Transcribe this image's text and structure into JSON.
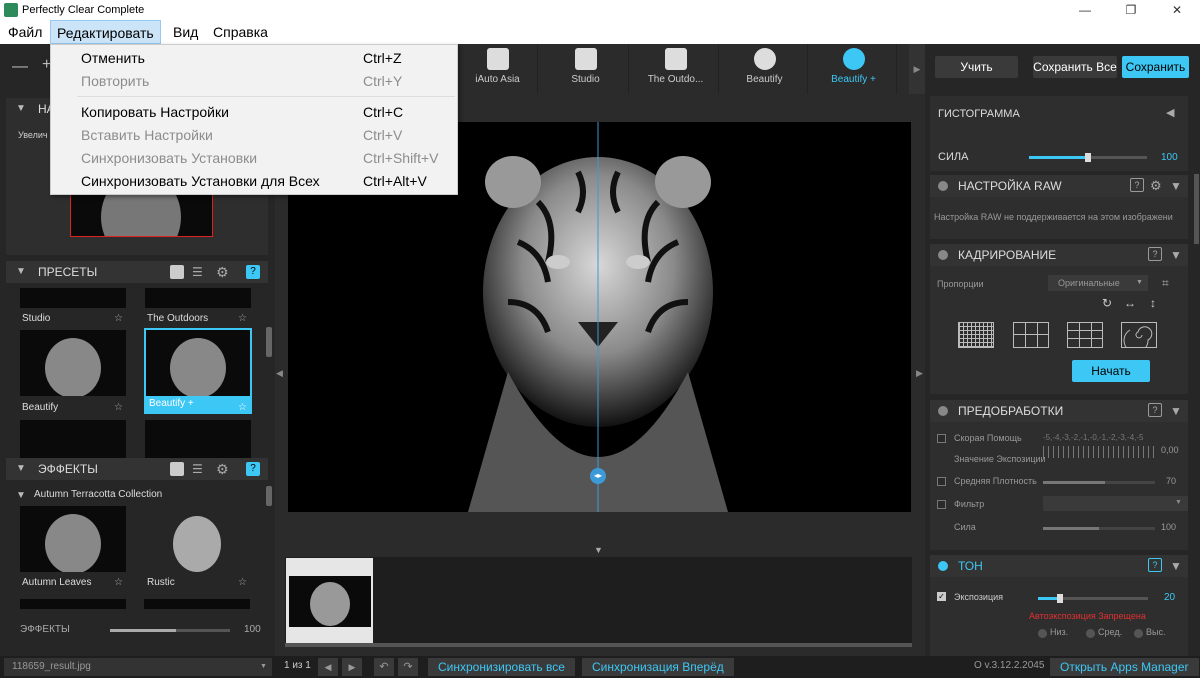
{
  "app": {
    "title": "Perfectly Clear Complete"
  },
  "window_controls": {
    "minimize": "—",
    "restore": "❐",
    "close": "✕"
  },
  "menubar": {
    "items": [
      "Файл",
      "Редактировать",
      "Вид",
      "Справка"
    ]
  },
  "edit_menu": {
    "items": [
      {
        "label": "Отменить",
        "shortcut": "Ctrl+Z",
        "enabled": true
      },
      {
        "label": "Повторить",
        "shortcut": "Ctrl+Y",
        "enabled": false
      },
      {
        "label": "Копировать Настройки",
        "shortcut": "Ctrl+C",
        "enabled": true
      },
      {
        "label": "Вставить Настройки",
        "shortcut": "Ctrl+V",
        "enabled": false
      },
      {
        "label": "Синхронизовать Установки",
        "shortcut": "Ctrl+Shift+V",
        "enabled": false
      },
      {
        "label": "Синхронизовать Установки для Всех",
        "shortcut": "Ctrl+Alt+V",
        "enabled": true
      }
    ]
  },
  "left": {
    "zoom_controls": [
      "—",
      "+"
    ],
    "navigator": {
      "title": "НА",
      "zoom_label": "Увелич"
    },
    "presets": {
      "title": "ПРЕСЕТЫ",
      "items": [
        {
          "label": "Studio"
        },
        {
          "label": "The Outdoors"
        },
        {
          "label": "Beautify"
        },
        {
          "label": "Beautify +",
          "selected": true
        }
      ]
    },
    "effects": {
      "title": "ЭФФЕКТЫ",
      "collection": "Autumn Terracotta Collection",
      "items": [
        {
          "label": "Autumn Leaves"
        },
        {
          "label": "Rustic"
        }
      ],
      "strength_label": "ЭФФЕКТЫ",
      "strength_value": "100",
      "strength": 0.55
    }
  },
  "toolbar": {
    "tools": [
      {
        "label": "iAuto Asia",
        "icon": "magic-wand-icon"
      },
      {
        "label": "Studio",
        "icon": "portrait-icon"
      },
      {
        "label": "The Outdo...",
        "icon": "landscape-icon"
      },
      {
        "label": "Beautify",
        "icon": "face-icon"
      },
      {
        "label": "Beautify +",
        "icon": "face-plus-icon",
        "active": true
      }
    ]
  },
  "right": {
    "buttons": {
      "apply": "Учить",
      "save_all": "Сохранить Все",
      "save": "Сохранить"
    },
    "histogram": {
      "title": "ГИСТОГРАММА"
    },
    "strength": {
      "label": "СИЛА",
      "value": "100",
      "level": 0.5
    },
    "raw": {
      "title": "НАСТРОЙКА RAW",
      "message": "Настройка RAW не поддерживается на этом изображени"
    },
    "crop": {
      "title": "КАДРИРОВАНИЕ",
      "proportions_label": "Пропорции",
      "proportions_value": "Оригинальные",
      "start_button": "Начать"
    },
    "preprocessing": {
      "title": "ПРЕДОБРАБОТКИ",
      "quick_help": "Скорая Помощь",
      "scale": "-5,-4,-3,-2,-1,-0,-1,-2,-3,-4,-5",
      "exposure_value_label": "Значение Экспозиции",
      "exposure_value": "0,00",
      "mid_density": "Средняя Плотность",
      "mid_density_value": "70",
      "filter": "Фильтр",
      "strength": "Сила",
      "strength_value": "100"
    },
    "tone": {
      "title": "ТОН",
      "exposure": "Экспозиция",
      "exposure_value": "20",
      "exposure_level": 0.2,
      "warning": "Автоэкспозиция Запрещена",
      "options": [
        "Низ.",
        "Сред.",
        "Выс."
      ]
    }
  },
  "status": {
    "filename": "118659_result.jpg",
    "page": "1 из 1",
    "sync_all": "Синхронизировать все",
    "sync_forward": "Синхронизация Вперёд",
    "version": "О v.3.12.2.2045",
    "apps_manager": "Открыть Apps Manager"
  },
  "colors": {
    "accent": "#3dc7f4",
    "warning": "#e03030",
    "selected_border": "#3dc7f4"
  }
}
